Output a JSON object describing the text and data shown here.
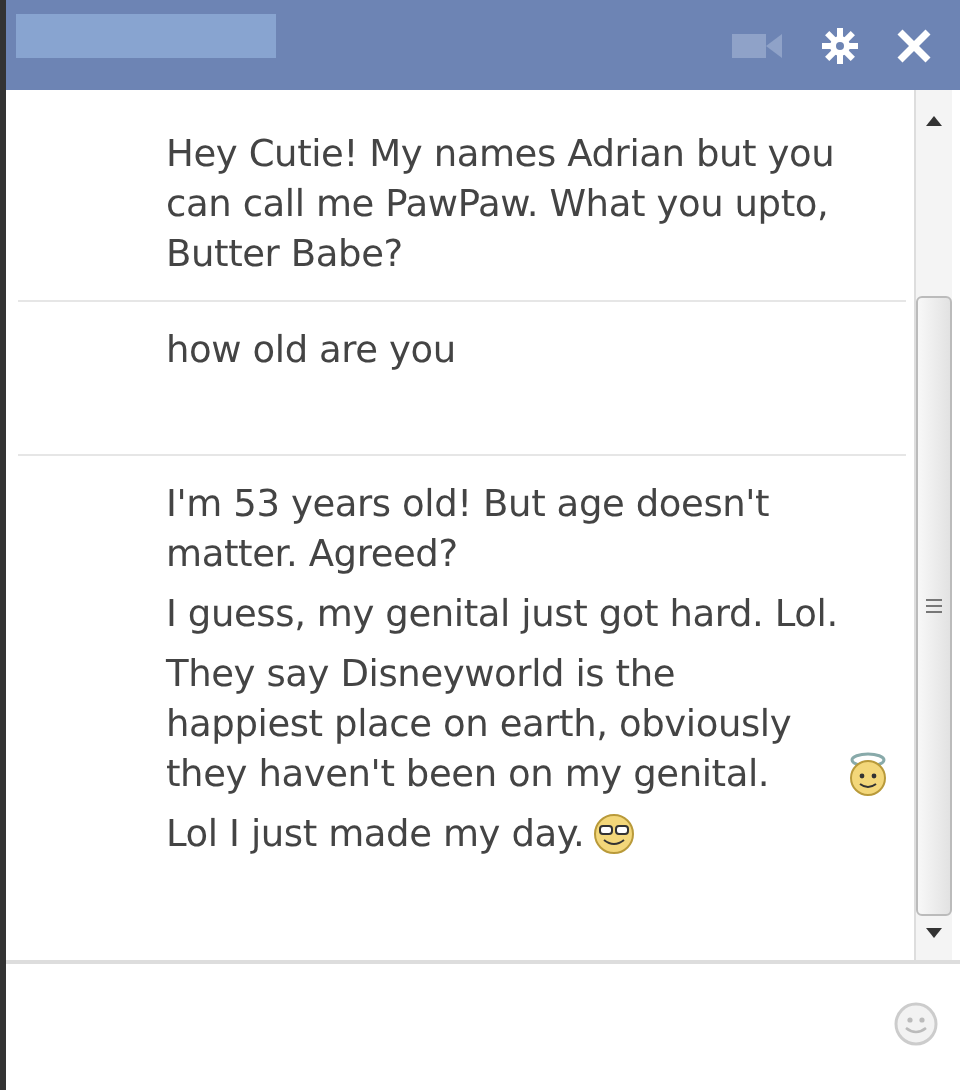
{
  "groups": [
    {
      "messages": [
        {
          "kind": "plain",
          "text": "Hey Cutie! My names Adrian but you can call me PawPaw. What you upto, Butter Babe?"
        }
      ]
    },
    {
      "messages": [
        {
          "kind": "plain",
          "text": "how old are you"
        }
      ]
    },
    {
      "messages": [
        {
          "kind": "plain",
          "text": "I'm 53 years old! But age doesn't matter. Agreed?"
        },
        {
          "kind": "plain",
          "text": "I guess, my genital just got hard. Lol."
        },
        {
          "kind": "angel",
          "text": "They say Disneyworld is the happiest place on earth, obviously they haven't been on my genital."
        },
        {
          "kind": "sunglasses",
          "text": "Lol I just made my day."
        }
      ]
    }
  ]
}
